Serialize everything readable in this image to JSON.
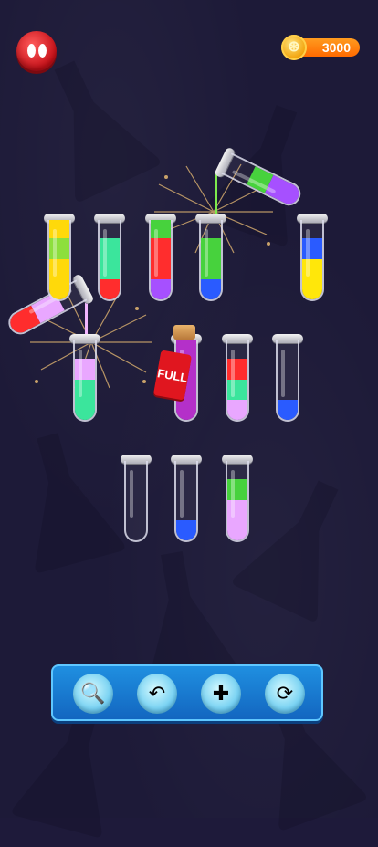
{
  "header": {
    "avatar_icon": "red-blob-avatar-icon",
    "coin_count": "3000",
    "coin_icon": "coin-icon",
    "coin_glyph": "⊛"
  },
  "tubes": [
    {
      "id": "tube-r1-1",
      "layers": [
        "#ffd90a",
        "#ffd90a",
        "#8ddf3d",
        "#ffd90a"
      ]
    },
    {
      "id": "tube-r1-2",
      "layers": [
        "#ff2d2d",
        "#3be59c",
        "#3be59c"
      ]
    },
    {
      "id": "tube-r1-3",
      "layers": [
        "#a650ff",
        "#ff2d2d",
        "#ff2d2d",
        "#47d23d"
      ]
    },
    {
      "id": "tube-r1-4",
      "layers": [
        "#2a5bff",
        "#47d23d",
        "#47d23d"
      ]
    },
    {
      "id": "tube-r1-5",
      "layers": [
        "#ffe70a",
        "#ffe70a",
        "#2a5bff"
      ]
    },
    {
      "id": "tube-r2-1",
      "layers": [
        "#3be59c",
        "#3be59c",
        "#e9a7ff"
      ]
    },
    {
      "id": "tube-r2-2",
      "layers": [
        "#b430c9",
        "#b430c9",
        "#b430c9",
        "#b430c9"
      ]
    },
    {
      "id": "tube-r2-3",
      "layers": [
        "#e9a7ff",
        "#3be59c",
        "#ff2d2d"
      ]
    },
    {
      "id": "tube-r2-4",
      "layers": [
        "#2a5bff"
      ]
    },
    {
      "id": "tube-r3-1",
      "layers": []
    },
    {
      "id": "tube-r3-2",
      "layers": [
        "#2a5bff"
      ]
    },
    {
      "id": "tube-r3-3",
      "layers": [
        "#e9a7ff",
        "#e9a7ff",
        "#47d23d"
      ]
    }
  ],
  "poured": {
    "top_right_tube": [
      "#47d23d",
      "#a650ff"
    ],
    "left_tube": [
      "#ff2d2d",
      "#e9a7ff"
    ]
  },
  "full_tag": "FULL",
  "tray": {
    "buttons": [
      {
        "name": "hint-button",
        "icon": "hint-icon",
        "glyph": "🔍"
      },
      {
        "name": "undo-button",
        "icon": "undo-icon",
        "glyph": "↶"
      },
      {
        "name": "add-tube-button",
        "icon": "add-tube-icon",
        "glyph": "✚"
      },
      {
        "name": "restart-button",
        "icon": "restart-icon",
        "glyph": "⟳"
      }
    ]
  }
}
